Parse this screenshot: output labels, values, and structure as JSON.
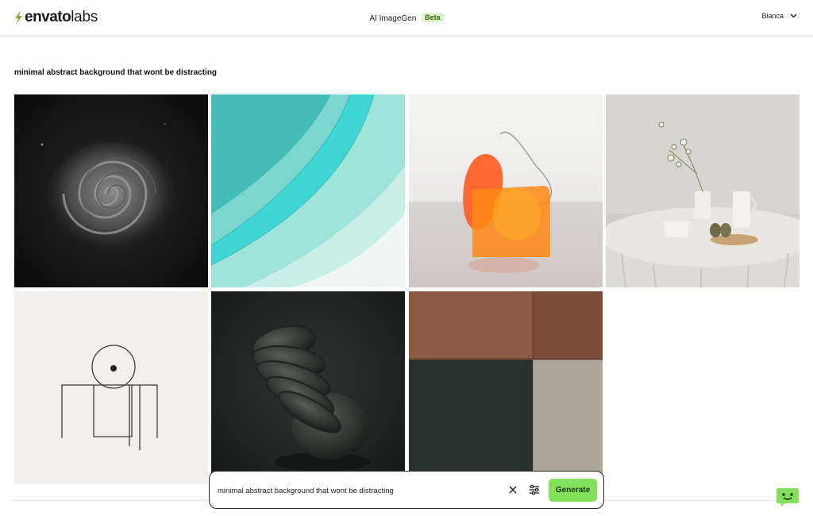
{
  "header": {
    "brand_primary": "envato",
    "brand_secondary": "labs",
    "app_title": "AI ImageGen",
    "badge": "Beta",
    "user_name": "Bianca",
    "brand_color": "#82b541"
  },
  "prompt": {
    "heading": "minimal abstract background that wont be distracting"
  },
  "results": [
    {
      "icon": "dark-spiral-image"
    },
    {
      "icon": "teal-waves-image"
    },
    {
      "icon": "orange-glass-shapes-image"
    },
    {
      "icon": "table-still-life-image"
    },
    {
      "icon": "line-art-figure-image"
    },
    {
      "icon": "dark-sculpture-image"
    },
    {
      "icon": "color-block-panels-image"
    }
  ],
  "generator": {
    "input_value": "minimal abstract background that wont be distracting",
    "generate_label": "Generate",
    "accent_color": "#82e05a"
  }
}
